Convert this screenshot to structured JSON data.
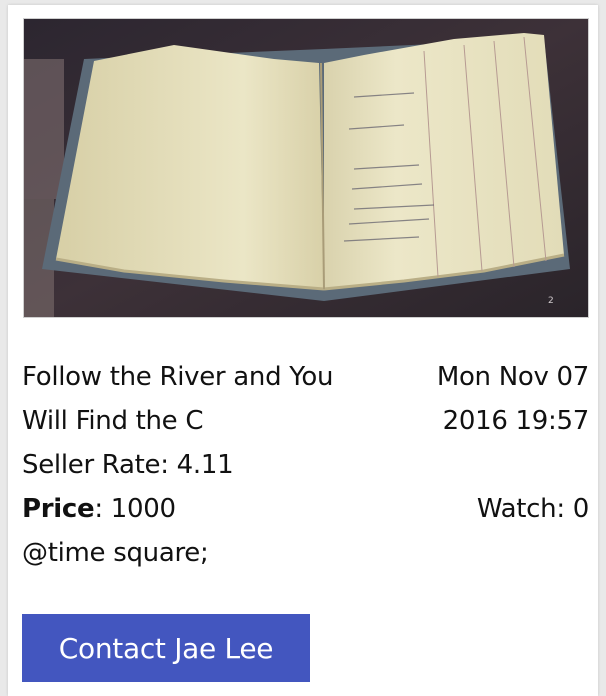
{
  "listing": {
    "image_alt": "open antique ledger book",
    "title": "Follow the River and You Will Find the C",
    "date": "Mon Nov 07 2016 19:57",
    "seller_rate_label": "Seller Rate:",
    "seller_rate": "4.11",
    "price_label": "Price",
    "price": ": 1000",
    "watch_label": "Watch:",
    "watch_count": "0",
    "location": "@time square;",
    "photo_number": "2"
  },
  "actions": {
    "contact_label": "Contact Jae Lee"
  },
  "colors": {
    "button": "#4356bf",
    "card": "#ffffff",
    "page_bg": "#e9e9e9"
  }
}
